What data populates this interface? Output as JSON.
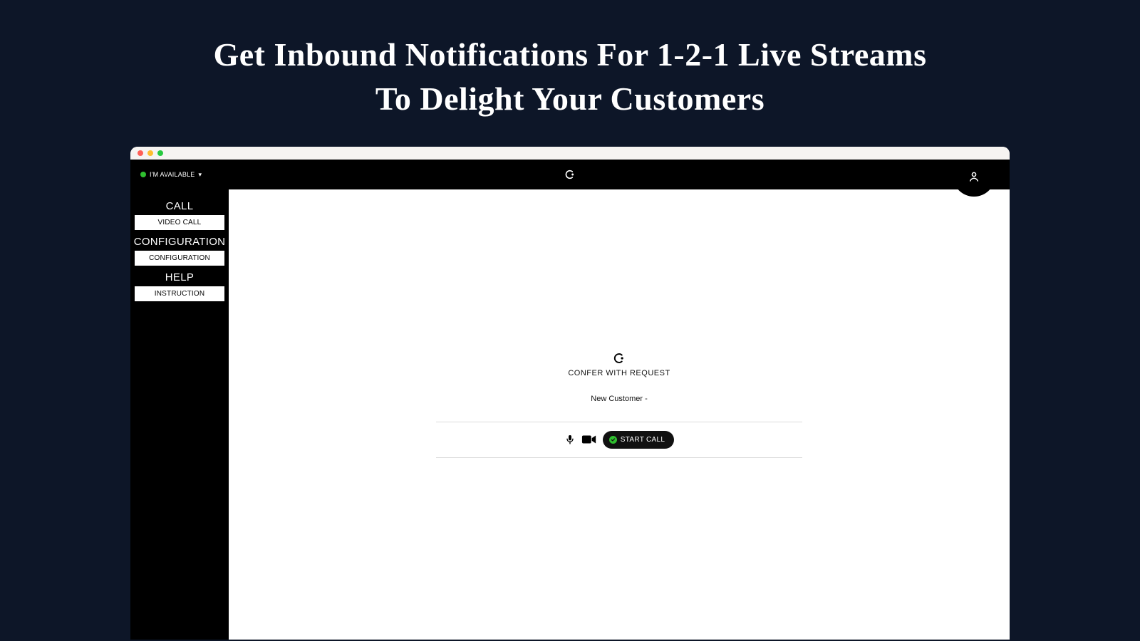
{
  "heading": {
    "line1": "Get Inbound  Notifications For 1-2-1 Live Streams",
    "line2": "To Delight Your Customers"
  },
  "header": {
    "status_label": "I'M AVAILABLE",
    "status_color": "#2fbf2f"
  },
  "sidebar": {
    "sections": [
      {
        "heading": "CALL",
        "items": [
          "VIDEO CALL"
        ]
      },
      {
        "heading": "CONFIGURATION",
        "items": [
          "CONFIGURATION"
        ]
      },
      {
        "heading": "HELP",
        "items": [
          "INSTRUCTION"
        ]
      }
    ]
  },
  "notification": {
    "title": "CONFER WITH REQUEST",
    "customer": "New Customer -",
    "start_call_label": "START CALL"
  }
}
